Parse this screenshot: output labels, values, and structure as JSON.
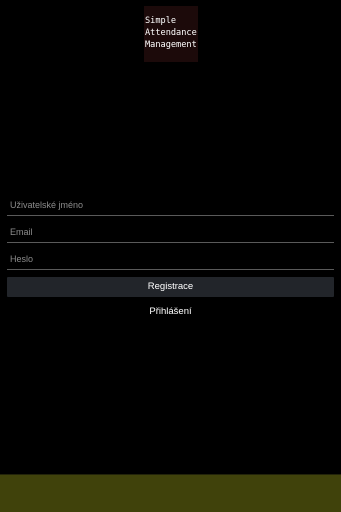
{
  "app": {
    "logo_lines": [
      "Simple",
      "Attendance",
      "Management"
    ]
  },
  "form": {
    "username": {
      "value": "",
      "placeholder": "Uživatelské jméno"
    },
    "email": {
      "value": "",
      "placeholder": "Email"
    },
    "password": {
      "value": "",
      "placeholder": "Heslo"
    },
    "register_label": "Registrace",
    "login_label": "Přihlášení"
  },
  "colors": {
    "background": "#000000",
    "logo_background": "#1c0a0a",
    "button_background": "#22252a",
    "bottom_bar": "#40420b"
  }
}
